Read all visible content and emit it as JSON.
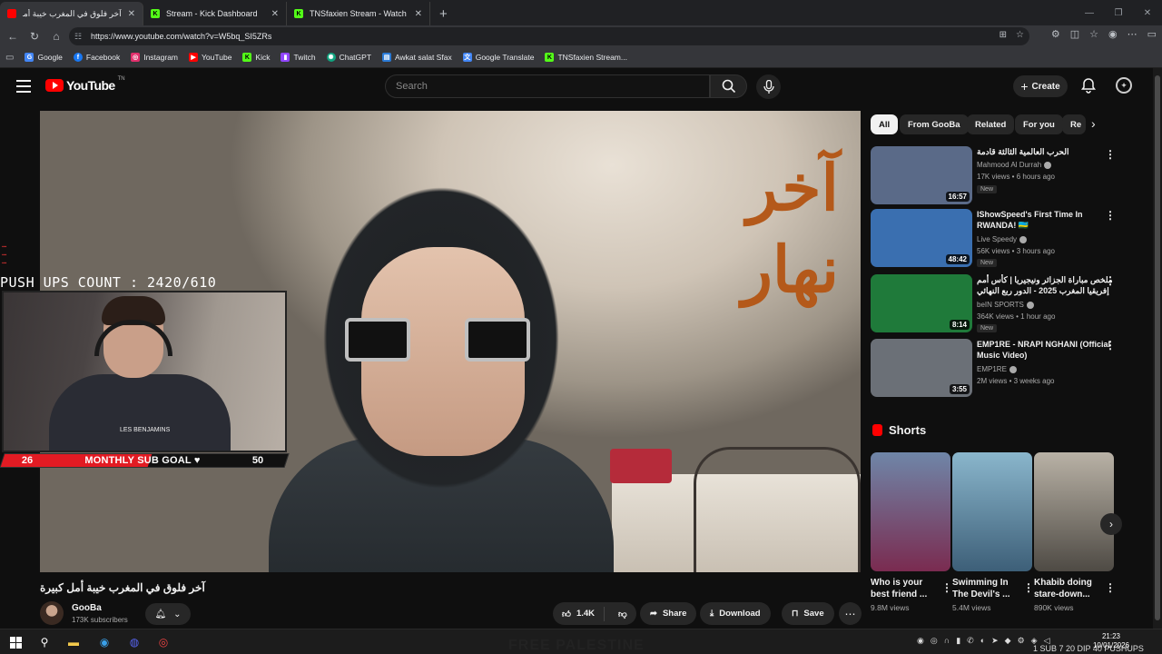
{
  "browser": {
    "tabs": [
      {
        "title": "آخر فلوق في المغرب خيبة أمل كبيرة",
        "active": true,
        "favicon_color": "#ff0000"
      },
      {
        "title": "Stream - Kick Dashboard",
        "active": false,
        "favicon_color": "#53fc18"
      },
      {
        "title": "TNSfaxien Stream - Watch Live on",
        "active": false,
        "favicon_color": "#53fc18"
      }
    ],
    "url": "https://www.youtube.com/watch?v=W5bq_SI5ZRs",
    "bookmarks": [
      {
        "label": "Google",
        "color": "#4285f4"
      },
      {
        "label": "Facebook",
        "color": "#1877f2"
      },
      {
        "label": "Instagram",
        "color": "#e1306c"
      },
      {
        "label": "YouTube",
        "color": "#ff0000"
      },
      {
        "label": "Kick",
        "color": "#53fc18"
      },
      {
        "label": "Twitch",
        "color": "#9146ff"
      },
      {
        "label": "ChatGPT",
        "color": "#10a37f"
      },
      {
        "label": "Awkat salat Sfax",
        "color": "#2b7bd6"
      },
      {
        "label": "Google Translate",
        "color": "#4285f4"
      },
      {
        "label": "TNSfaxien Stream...",
        "color": "#53fc18"
      }
    ]
  },
  "youtube": {
    "logo": "YouTube",
    "country_code": "TN",
    "search_placeholder": "Search",
    "create_label": "Create"
  },
  "overlay": {
    "pushups": "PUSH UPS COUNT : 2420/610",
    "sub_goal_left": "26",
    "sub_goal_label": "MONTHLY SUB GOAL ♥",
    "sub_goal_right": "50",
    "sub_goal_progress": 0.52,
    "shirt_text": "LES BENJAMINS"
  },
  "video": {
    "overlay_text_line1": "آخر",
    "overlay_text_line2": "نهار",
    "title": "آخر فلوق في المغرب خيبة أمل كبيرة",
    "channel": "GooBa",
    "subscribers": "173K subscribers",
    "likes": "1.4K",
    "share_label": "Share",
    "download_label": "Download",
    "save_label": "Save"
  },
  "chips": [
    "All",
    "From GooBa",
    "Related",
    "For you",
    "Re"
  ],
  "recommendations": [
    {
      "title": "الحرب العالمية الثالثة قادمة",
      "channel": "Mahmood Al Durrah",
      "meta": "17K views • 6 hours ago",
      "duration": "16:57",
      "is_new": true,
      "new_label": "New",
      "thumb": "#5a6a88"
    },
    {
      "title": "IShowSpeed's First Time In RWANDA! 🇷🇼",
      "channel": "Live Speedy",
      "meta": "56K views • 3 hours ago",
      "duration": "48:42",
      "is_new": true,
      "new_label": "New",
      "thumb": "#3a6fb0"
    },
    {
      "title": "ملخص مباراة الجزائر ونيجيريا | كأس أمم إفريقيا المغرب 2025 - الدور ربع النهائي",
      "channel": "beIN SPORTS",
      "meta": "364K views • 1 hour ago",
      "duration": "8:14",
      "is_new": true,
      "new_label": "New",
      "thumb": "#1f7a3a"
    },
    {
      "title": "EMP1RE - NRAPI NGHANI (Official Music Video)",
      "channel": "EMP1RE",
      "meta": "2M views • 3 weeks ago",
      "duration": "3:55",
      "is_new": false,
      "new_label": "",
      "thumb": "#6b7077"
    }
  ],
  "shorts": {
    "heading": "Shorts",
    "items": [
      {
        "title": "Who is your best friend ...",
        "views": "9.8M views",
        "thumb": "#7a2b50"
      },
      {
        "title": "Swimming In The Devil's ...",
        "views": "5.4M views",
        "thumb": "#3d5f78"
      },
      {
        "title": "Khabib doing stare-down...",
        "views": "890K views",
        "thumb": "#4e4a44"
      }
    ]
  },
  "taskbar": {
    "time": "21:23",
    "date": "10/01/2026",
    "banner": "FREE PALESTINE",
    "ticker": "1 SUB 7 20 DIP 40 PUSHUPS"
  }
}
